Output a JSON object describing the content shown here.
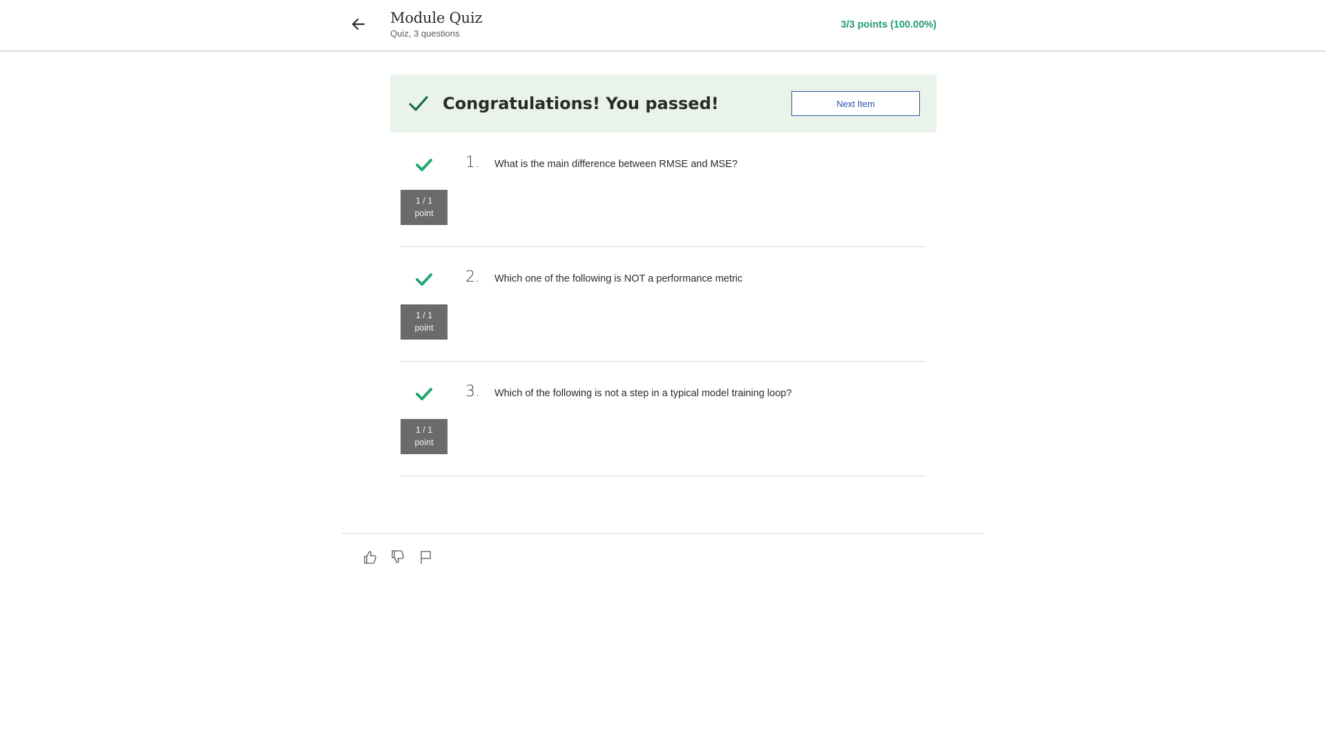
{
  "header": {
    "title": "Module Quiz",
    "subtitle": "Quiz, 3 questions",
    "score": "3/3 points (100.00%)"
  },
  "banner": {
    "message": "Congratulations! You passed!",
    "next_label": "Next Item"
  },
  "questions": [
    {
      "number": "1.",
      "text": "What is the main difference between RMSE and MSE?",
      "points_line1": "1 / 1",
      "points_line2": "point",
      "status": "correct"
    },
    {
      "number": "2.",
      "text": "Which one of the following is NOT a performance metric",
      "points_line1": "1 / 1",
      "points_line2": "point",
      "status": "correct"
    },
    {
      "number": "3.",
      "text": "Which of the following is not a step in a typical model training loop?",
      "points_line1": "1 / 1",
      "points_line2": "point",
      "status": "correct"
    }
  ],
  "feedback": {
    "icons": [
      "thumbs-up-icon",
      "thumbs-down-icon",
      "flag-icon"
    ]
  },
  "colors": {
    "success": "#1f9e6a",
    "banner_bg": "#eaf3e9",
    "link": "#2a4fa8",
    "points_bg": "#6b6b6b"
  }
}
